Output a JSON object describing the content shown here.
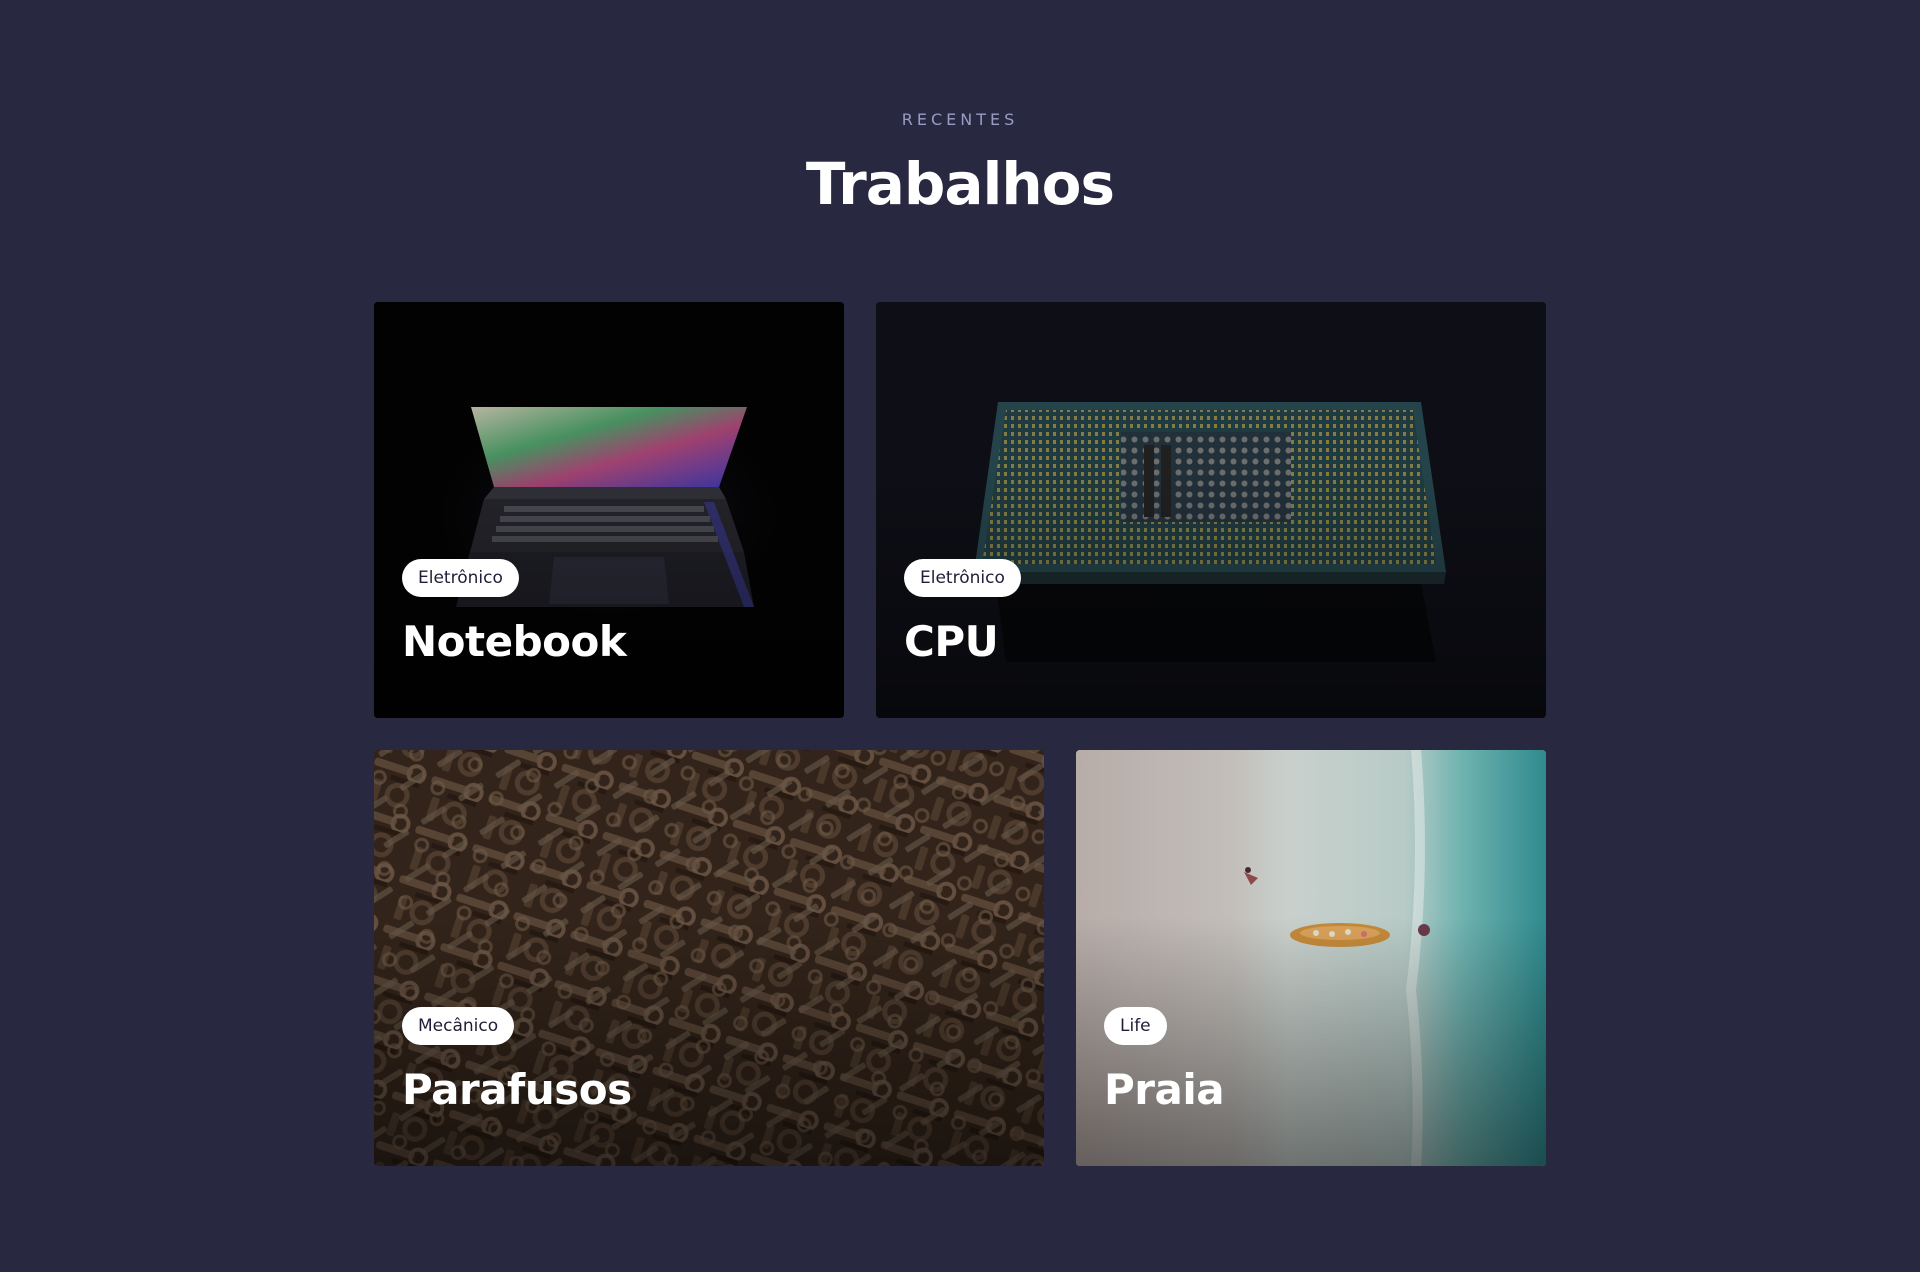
{
  "header": {
    "eyebrow": "RECENTES",
    "title": "Trabalhos"
  },
  "projects": [
    {
      "category": "Eletrônico",
      "title": "Notebook",
      "image": "laptop-photo"
    },
    {
      "category": "Eletrônico",
      "title": "CPU",
      "image": "cpu-photo"
    },
    {
      "category": "Mecânico",
      "title": "Parafusos",
      "image": "screws-photo"
    },
    {
      "category": "Life",
      "title": "Praia",
      "image": "beach-photo"
    }
  ],
  "colors": {
    "background": "#282840",
    "eyebrow": "#9a9bc4",
    "badge_bg": "#ffffff",
    "badge_text": "#1e1e38"
  }
}
